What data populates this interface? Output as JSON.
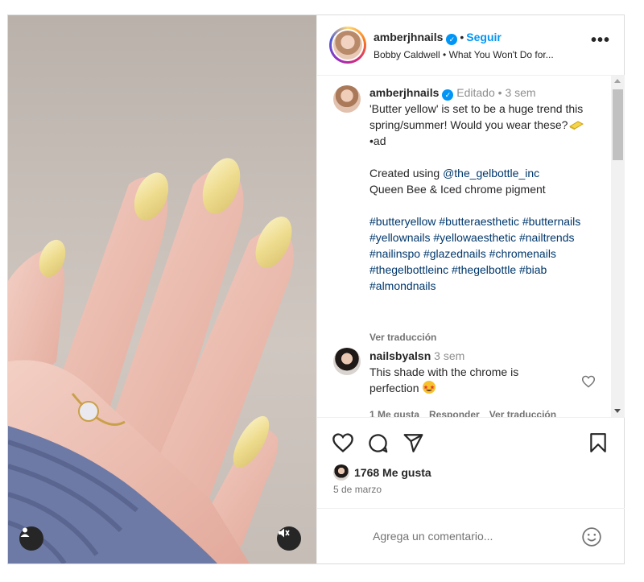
{
  "header": {
    "username": "amberjhnails",
    "follow_label": "Seguir",
    "audio": "Bobby Caldwell • What You Won't Do for..."
  },
  "caption": {
    "username": "amberjhnails",
    "edited": "Editado",
    "time": "3 sem",
    "text_line1": "'Butter yellow' is set to be a huge trend this spring/summer! Would you wear these?",
    "text_after_emoji": "•ad",
    "created_prefix": "Created using ",
    "mention": "@the_gelbottle_inc",
    "products": "Queen Bee & Iced chrome pigment",
    "hashtags": "#butteryellow #butteraesthetic #butternails #yellownails #yellowaesthetic #nailtrends #nailinspo #glazednails #chromenails #thegelbottleinc #thegelbottle #biab #almondnails",
    "see_translation": "Ver traducción"
  },
  "comment": {
    "username": "nailsbyalsn",
    "time": "3 sem",
    "text": "This shade with the chrome is perfection",
    "likes": "1 Me gusta",
    "reply": "Responder",
    "see_translation": "Ver traducción"
  },
  "actions": {
    "likes_count": "1768 Me gusta",
    "date": "5 de marzo"
  },
  "add_comment": {
    "placeholder": "Agrega un comentario..."
  }
}
